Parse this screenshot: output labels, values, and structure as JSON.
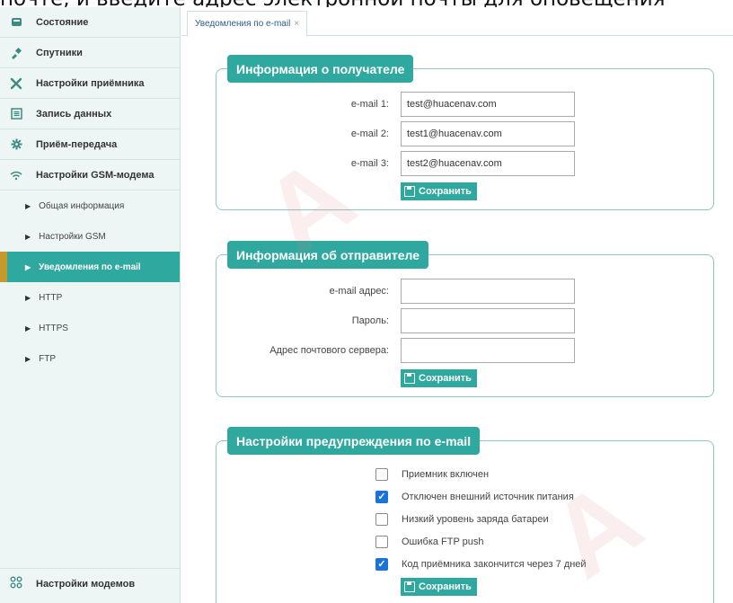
{
  "caption": "почте, и введите адрес электронной почты для оповещения",
  "sidebar": {
    "items": [
      {
        "label": "Состояние",
        "icon": "status-icon"
      },
      {
        "label": "Спутники",
        "icon": "satellite-icon"
      },
      {
        "label": "Настройки приёмника",
        "icon": "tools-icon"
      },
      {
        "label": "Запись данных",
        "icon": "record-icon"
      },
      {
        "label": "Приём-передача",
        "icon": "gear-icon"
      },
      {
        "label": "Настройки GSM-модема",
        "icon": "wifi-icon"
      }
    ],
    "subitems": [
      {
        "label": "Общая информация",
        "active": false
      },
      {
        "label": "Настройки GSM",
        "active": false
      },
      {
        "label": "Уведомления по e-mail",
        "active": true
      },
      {
        "label": "HTTP",
        "active": false
      },
      {
        "label": "HTTPS",
        "active": false
      },
      {
        "label": "FTP",
        "active": false
      }
    ],
    "bottom": {
      "label": "Настройки модемов",
      "icon": "modem-settings-icon"
    }
  },
  "tab": {
    "label": "Уведомления по e-mail",
    "close": "×"
  },
  "recipient": {
    "title": "Информация о получателе",
    "fields": [
      {
        "label": "e-mail 1:",
        "value": "test@huacenav.com"
      },
      {
        "label": "e-mail 2:",
        "value": "test1@huacenav.com"
      },
      {
        "label": "e-mail 3:",
        "value": "test2@huacenav.com"
      }
    ],
    "save": "Сохранить"
  },
  "sender": {
    "title": "Информация об отправителе",
    "fields": [
      {
        "label": "e-mail адрес:",
        "value": ""
      },
      {
        "label": "Пароль:",
        "value": ""
      },
      {
        "label": "Адрес почтового сервера:",
        "value": ""
      }
    ],
    "save": "Сохранить"
  },
  "alerts": {
    "title": "Настройки предупреждения по e-mail",
    "options": [
      {
        "label": "Приемник включен",
        "checked": false
      },
      {
        "label": "Отключен внешний источник питания",
        "checked": true
      },
      {
        "label": "Низкий уровень заряда батареи",
        "checked": false
      },
      {
        "label": "Ошибка FTP push",
        "checked": false
      },
      {
        "label": "Код приёмника закончится через 7 дней",
        "checked": true
      }
    ],
    "save": "Сохранить"
  },
  "colors": {
    "accent": "#2fa99f",
    "active_marker": "#c49a2e",
    "checkbox": "#1a73d9"
  }
}
